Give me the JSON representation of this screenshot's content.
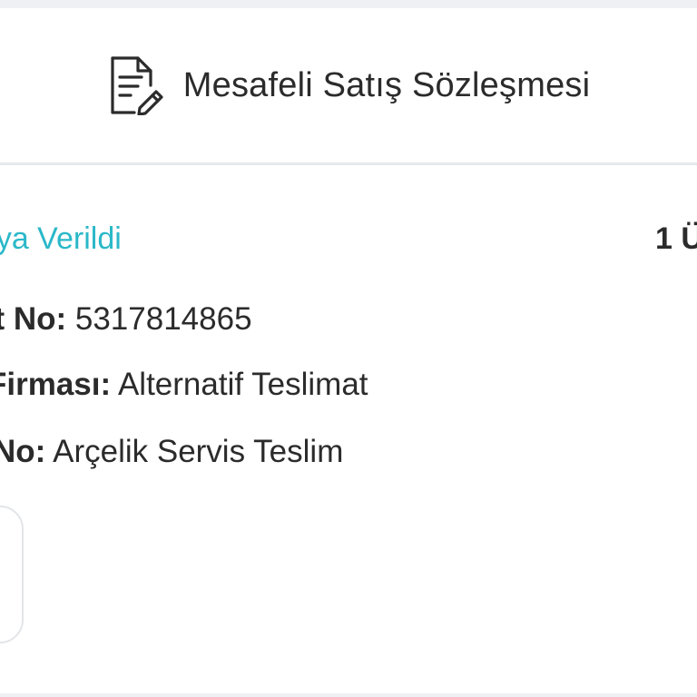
{
  "contract": {
    "label": "Mesafeli Satış Sözleşmesi",
    "icon": "document-edit-icon"
  },
  "order": {
    "status": "goya Verildi",
    "status_color": "#2bb8c9",
    "item_count": "1 Ü",
    "tracking": {
      "key": "at No:",
      "value": " 5317814865"
    },
    "carrier": {
      "key": "Firması:",
      "value": " Alternatif Teslimat"
    },
    "delivery": {
      "key": "No:",
      "value": " Arçelik Servis Teslim"
    }
  }
}
